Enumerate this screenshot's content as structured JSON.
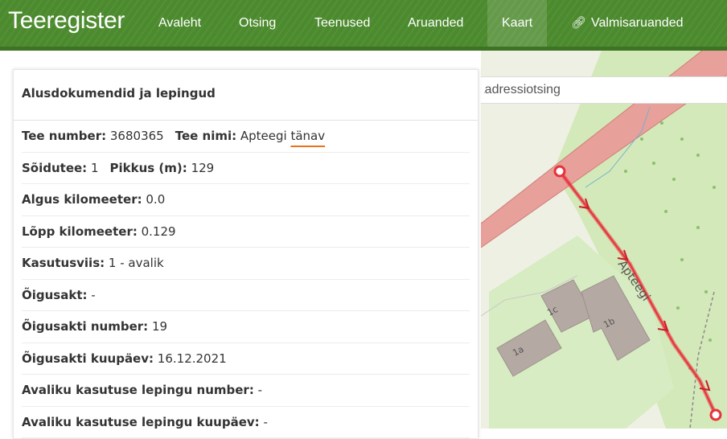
{
  "navbar": {
    "brand": "Teeregister",
    "items": [
      {
        "label": "Avaleht"
      },
      {
        "label": "Otsing"
      },
      {
        "label": "Teenused"
      },
      {
        "label": "Aruanded"
      },
      {
        "label": "Kaart",
        "active": true
      },
      {
        "label": "Valmisaruanded",
        "icon": "link-icon"
      }
    ]
  },
  "panel": {
    "title": "Alusdokumendid ja lepingud",
    "row1": {
      "number_label": "Tee number:",
      "number_value": "3680365",
      "name_label": "Tee nimi:",
      "name_value_prefix": "Apteegi ",
      "name_value_underlined": "tänav"
    },
    "row2": {
      "lane_label": "Sõidutee:",
      "lane_value": "1",
      "length_label": "Pikkus (m):",
      "length_value": "129"
    },
    "row3": {
      "label": "Algus kilomeeter:",
      "value": "0.0"
    },
    "row4": {
      "label": "Lõpp kilomeeter:",
      "value": "0.129"
    },
    "row5": {
      "label": "Kasutusviis:",
      "value": "1 - avalik"
    },
    "row6": {
      "label": "Õigusakt:",
      "value": "-"
    },
    "row7": {
      "label": "Õigusakti number:",
      "value": "19"
    },
    "row8": {
      "label": "Õigusakti kuupäev:",
      "value": "16.12.2021"
    },
    "row9": {
      "label": "Avaliku kasutuse lepingu number:",
      "value": "-"
    },
    "row10": {
      "label": "Avaliku kasutuse lepingu kuupäev:",
      "value": "-"
    }
  },
  "map": {
    "search_placeholder": "Aadressiotsing",
    "street_label": "Apteegi",
    "house_numbers": [
      "1a",
      "1c",
      "1b"
    ],
    "colors": {
      "road": "#e8a09a",
      "route": "#e8323c",
      "building": "#b5a9a3",
      "grass": "#cfe8b4",
      "background": "#eef0e4"
    }
  }
}
